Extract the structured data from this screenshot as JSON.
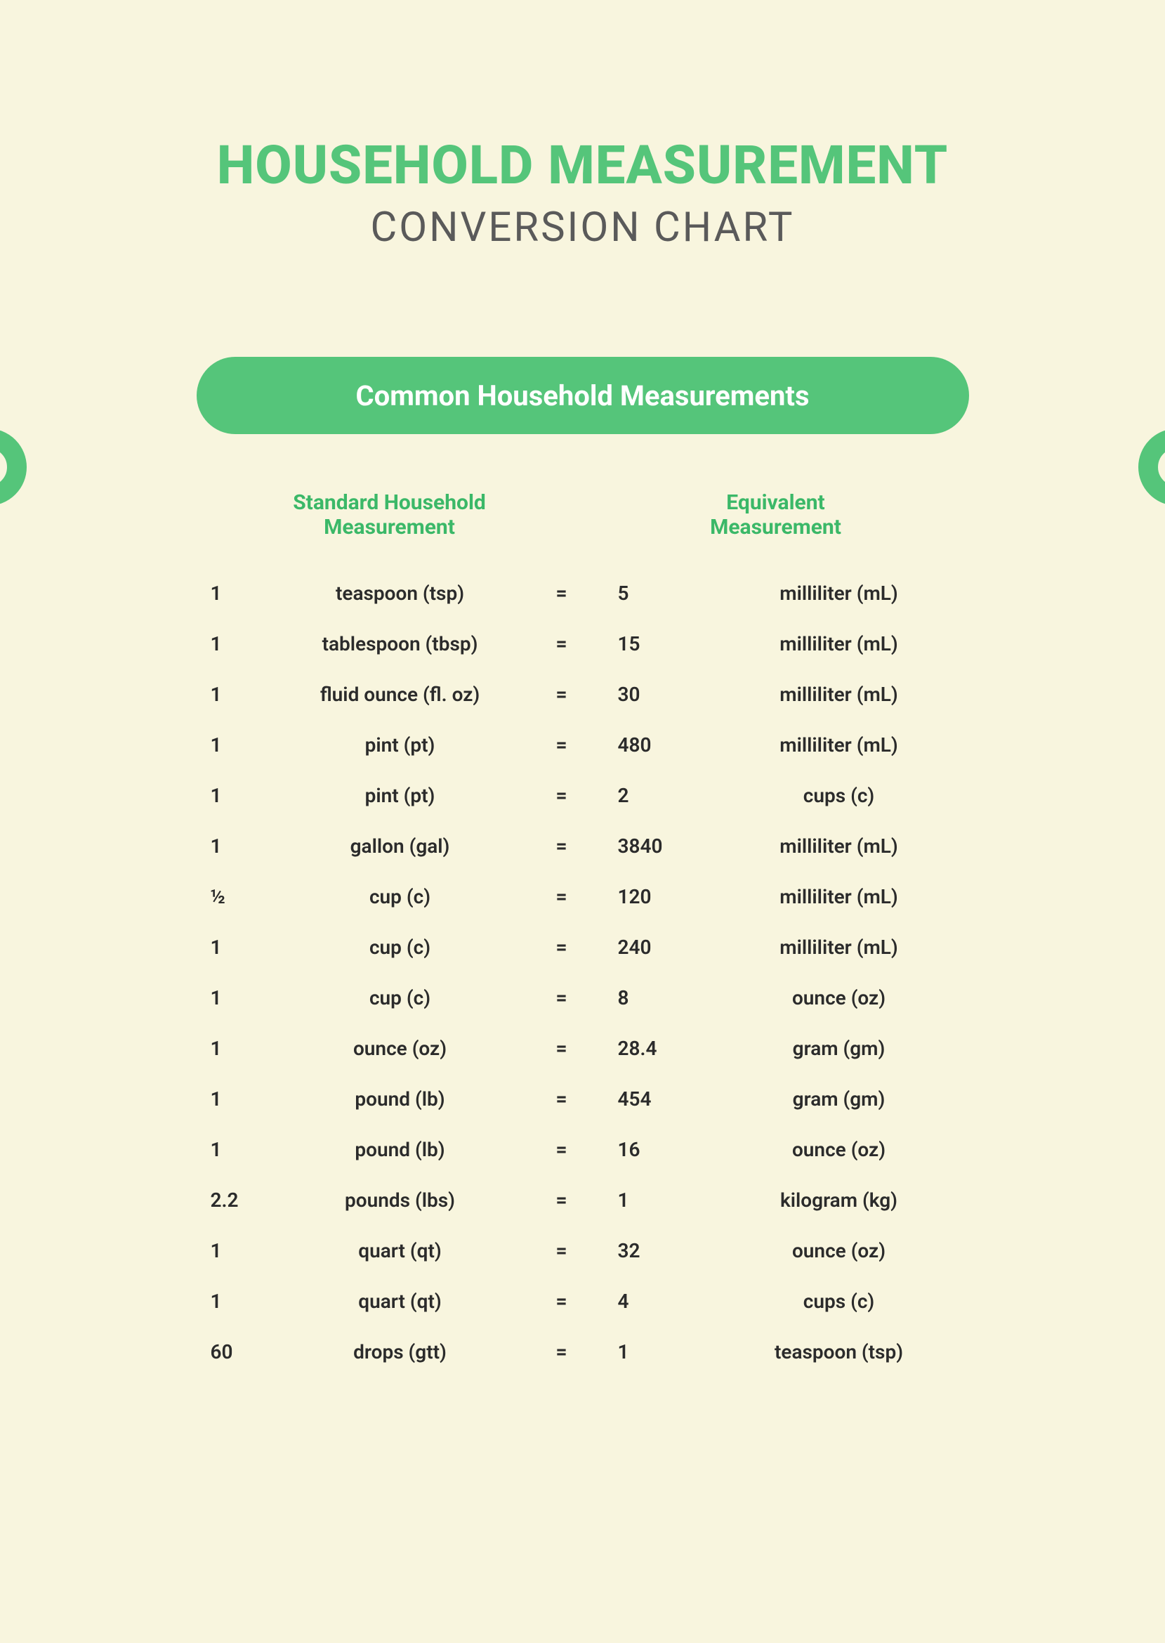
{
  "title": {
    "main": "HOUSEHOLD MEASUREMENT",
    "sub": "CONVERSION CHART"
  },
  "section_label": "Common Household Measurements",
  "columns": {
    "left": "Standard Household\nMeasurement",
    "right": "Equivalent\nMeasurement"
  },
  "rows": [
    {
      "qty_a": "1",
      "unit_a": "teaspoon (tsp)",
      "eq": "=",
      "qty_b": "5",
      "unit_b": "milliliter (mL)"
    },
    {
      "qty_a": "1",
      "unit_a": "tablespoon (tbsp)",
      "eq": "=",
      "qty_b": "15",
      "unit_b": "milliliter (mL)"
    },
    {
      "qty_a": "1",
      "unit_a": "fluid ounce (fl. oz)",
      "eq": "=",
      "qty_b": "30",
      "unit_b": "milliliter (mL)"
    },
    {
      "qty_a": "1",
      "unit_a": "pint (pt)",
      "eq": "=",
      "qty_b": "480",
      "unit_b": "milliliter (mL)"
    },
    {
      "qty_a": "1",
      "unit_a": "pint (pt)",
      "eq": "=",
      "qty_b": "2",
      "unit_b": "cups (c)"
    },
    {
      "qty_a": "1",
      "unit_a": "gallon (gal)",
      "eq": "=",
      "qty_b": "3840",
      "unit_b": "milliliter (mL)"
    },
    {
      "qty_a": "½",
      "unit_a": "cup (c)",
      "eq": "=",
      "qty_b": "120",
      "unit_b": "milliliter (mL)"
    },
    {
      "qty_a": "1",
      "unit_a": "cup (c)",
      "eq": "=",
      "qty_b": "240",
      "unit_b": "milliliter (mL)"
    },
    {
      "qty_a": "1",
      "unit_a": "cup (c)",
      "eq": "=",
      "qty_b": "8",
      "unit_b": "ounce (oz)"
    },
    {
      "qty_a": "1",
      "unit_a": "ounce (oz)",
      "eq": "=",
      "qty_b": "28.4",
      "unit_b": "gram (gm)"
    },
    {
      "qty_a": "1",
      "unit_a": "pound (lb)",
      "eq": "=",
      "qty_b": "454",
      "unit_b": "gram (gm)"
    },
    {
      "qty_a": "1",
      "unit_a": "pound (lb)",
      "eq": "=",
      "qty_b": "16",
      "unit_b": "ounce (oz)"
    },
    {
      "qty_a": "2.2",
      "unit_a": "pounds (lbs)",
      "eq": "=",
      "qty_b": "1",
      "unit_b": "kilogram (kg)"
    },
    {
      "qty_a": "1",
      "unit_a": "quart (qt)",
      "eq": "=",
      "qty_b": "32",
      "unit_b": "ounce (oz)"
    },
    {
      "qty_a": "1",
      "unit_a": "quart (qt)",
      "eq": "=",
      "qty_b": "4",
      "unit_b": "cups (c)"
    },
    {
      "qty_a": "60",
      "unit_a": "drops (gtt)",
      "eq": "=",
      "qty_b": "1",
      "unit_b": "teaspoon (tsp)"
    }
  ]
}
